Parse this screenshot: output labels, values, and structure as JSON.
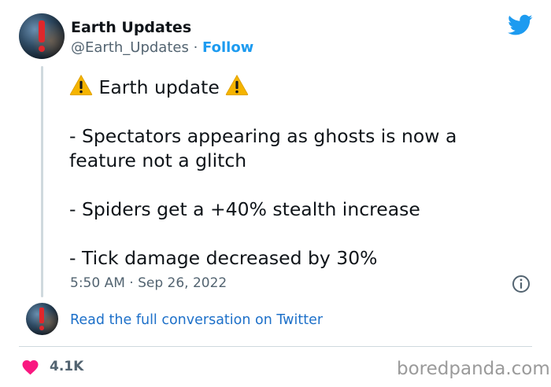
{
  "author": {
    "name": "Earth Updates",
    "handle": "@Earth_Updates",
    "separator": "·",
    "follow_label": "Follow",
    "avatar_icon": "earth-exclamation-avatar"
  },
  "platform_icon": "twitter-bird-icon",
  "tweet": {
    "title": "Earth update",
    "title_icon": "warning-icon",
    "lines": [
      "- Spectators appearing as ghosts is now a",
      "feature not a glitch",
      "- Spiders get a +40% stealth increase",
      "- Tick damage decreased by 30%"
    ],
    "timestamp": "5:50 AM · Sep 26, 2022"
  },
  "conversation_link": "Read the full conversation on Twitter",
  "likes": "4.1K",
  "watermark": "boredpanda.com",
  "colors": {
    "accent": "#1d9bf0",
    "link": "#1d70c9",
    "heart": "#f91880",
    "muted": "#536471",
    "warning": "#f5b400"
  }
}
